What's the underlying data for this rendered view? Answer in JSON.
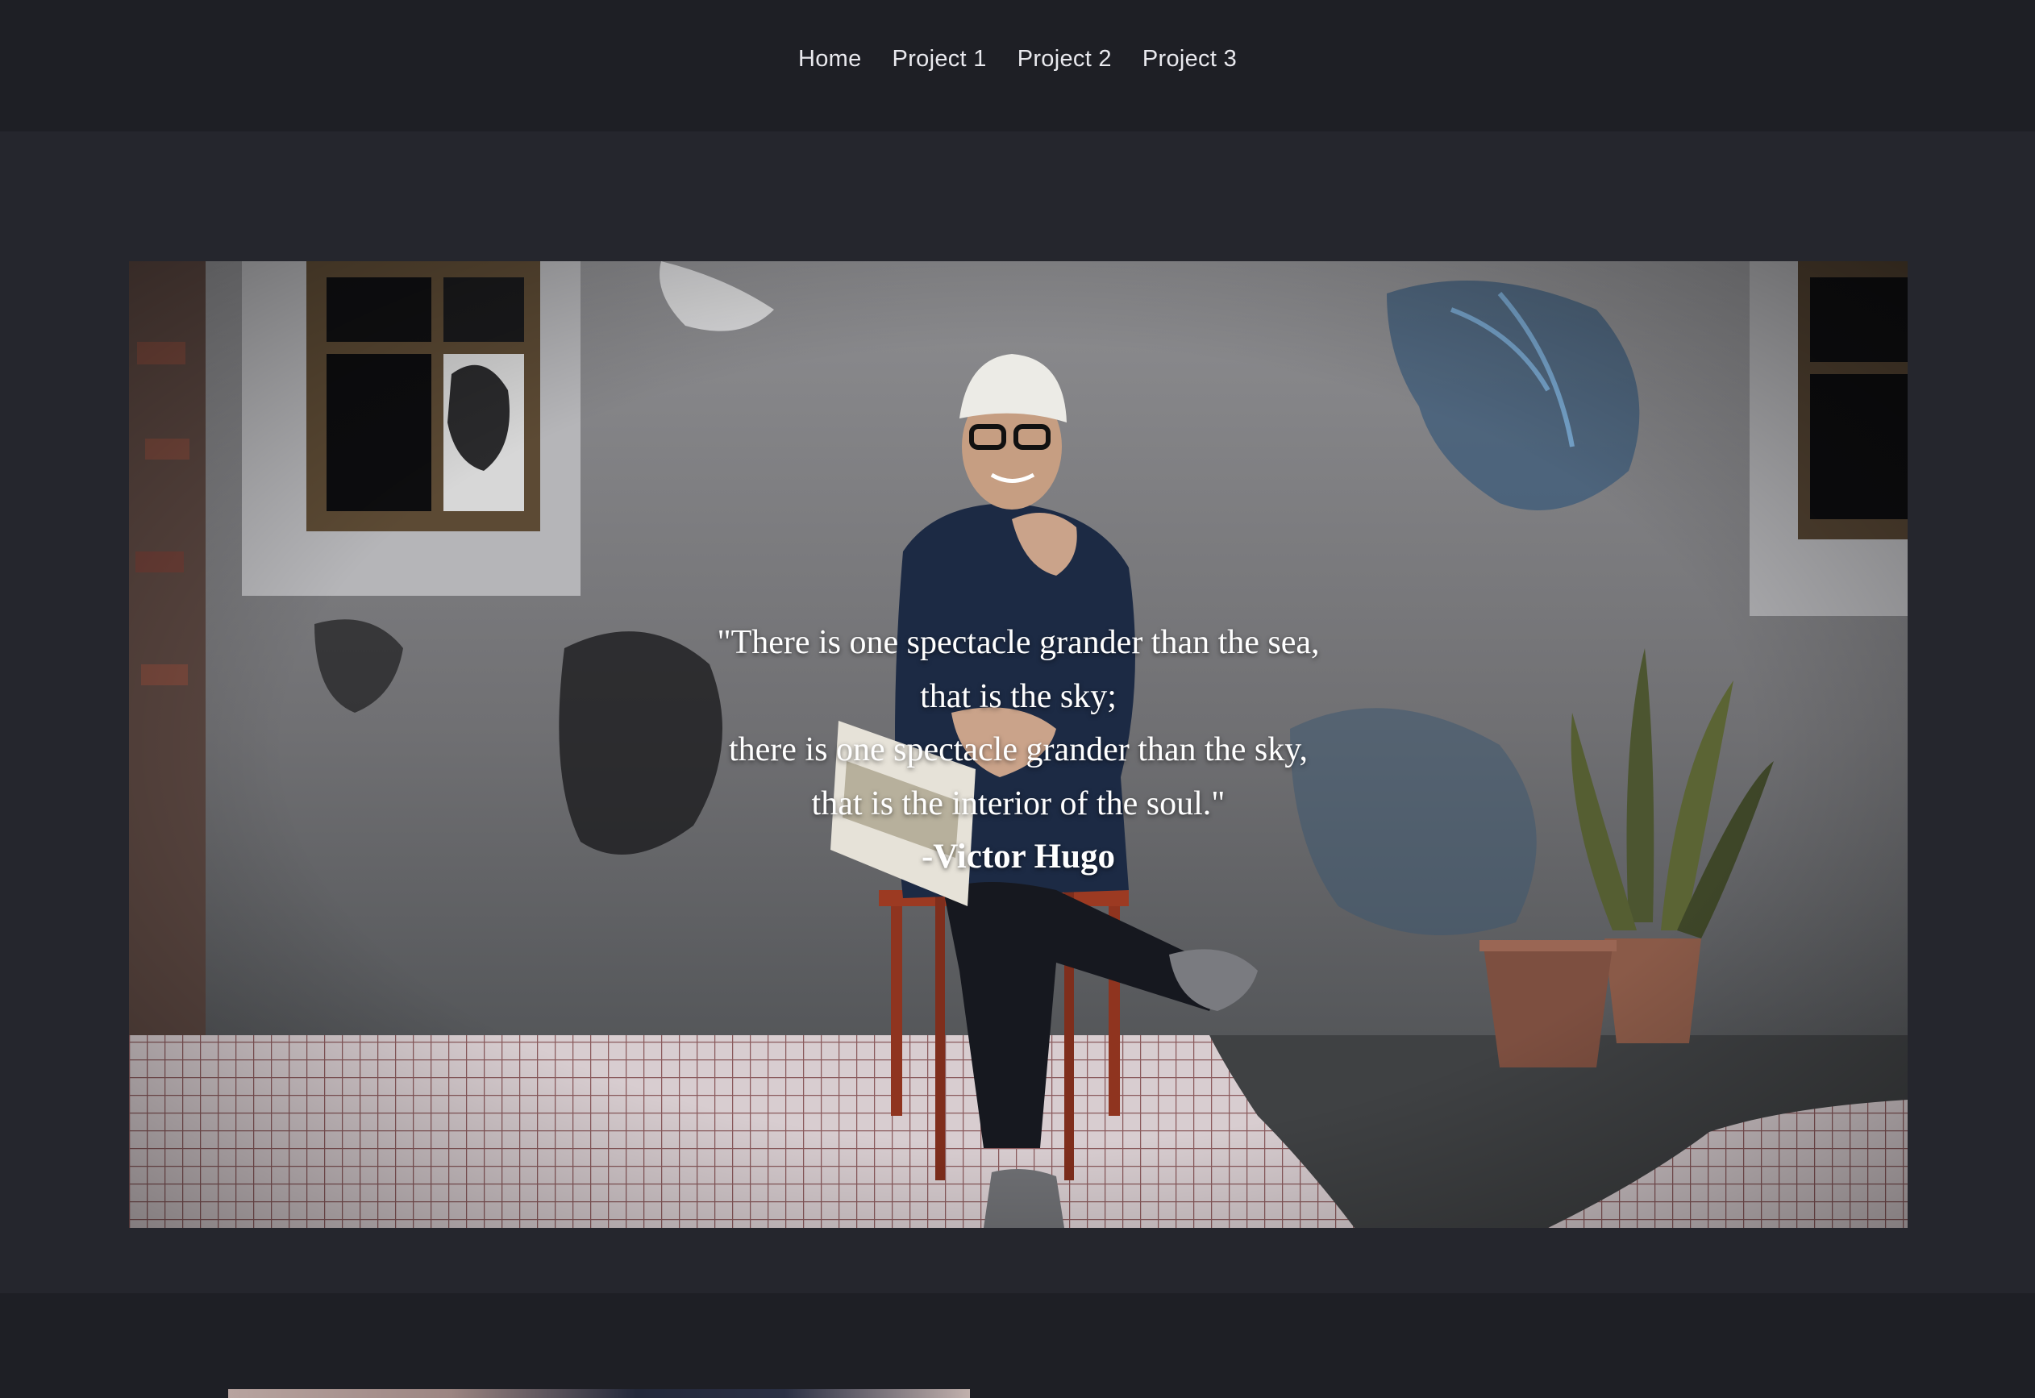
{
  "nav": {
    "items": [
      {
        "label": "Home"
      },
      {
        "label": "Project 1"
      },
      {
        "label": "Project 2"
      },
      {
        "label": "Project 3"
      }
    ]
  },
  "hero": {
    "quote_lines": [
      "\"There is one spectacle grander than the sea,",
      "that is the sky;",
      "there is one spectacle grander than the sky,",
      "that is the interior of the soul.\""
    ],
    "author": "-Victor Hugo"
  },
  "colors": {
    "nav_bg": "#1e1f25",
    "section_bg": "#25262d",
    "text": "#ffffff"
  }
}
